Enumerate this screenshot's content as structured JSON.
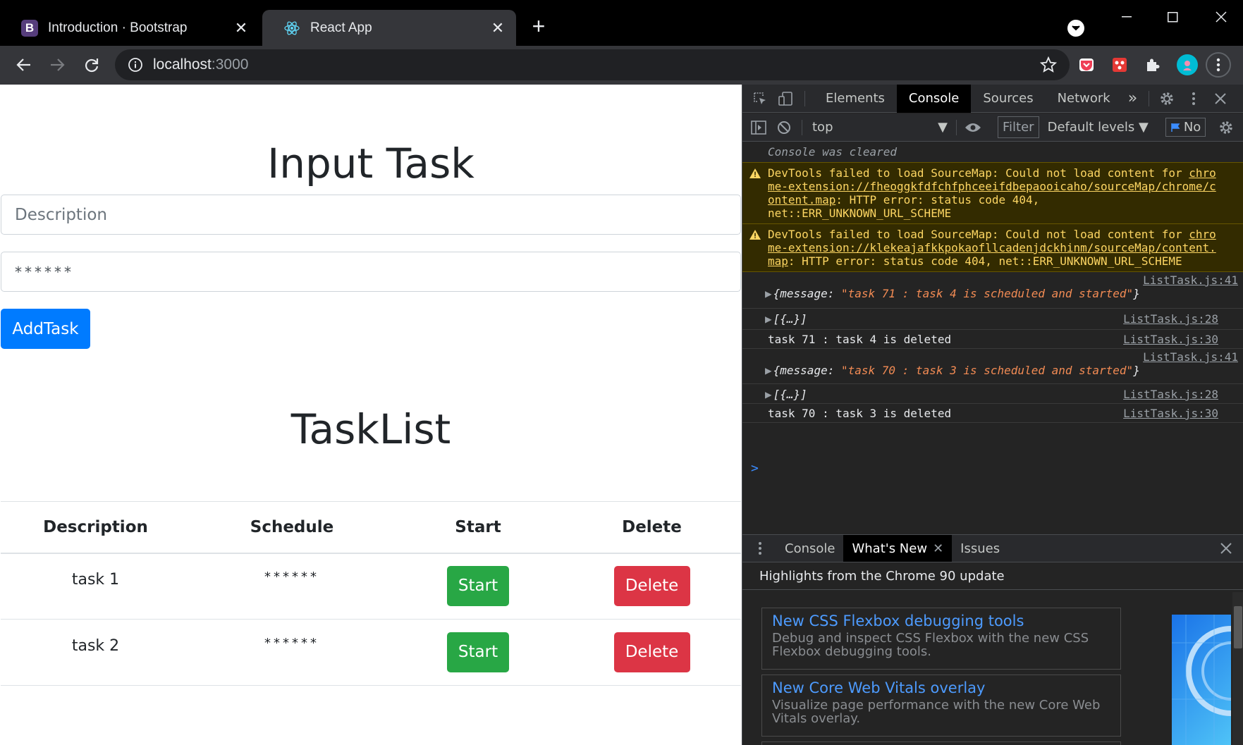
{
  "browser": {
    "tabs": [
      {
        "title": "Introduction · Bootstrap",
        "favicon": "B"
      },
      {
        "title": "React App"
      }
    ],
    "url_host": "localhost",
    "url_port": ":3000"
  },
  "page": {
    "input_title": "Input Task",
    "description_placeholder": "Description",
    "schedule_value": "******",
    "addtask_label": "AddTask",
    "list_title": "TaskList",
    "table": {
      "headers": [
        "Description",
        "Schedule",
        "Start",
        "Delete"
      ],
      "rows": [
        {
          "description": "task 1",
          "schedule": "******",
          "start": "Start",
          "delete": "Delete"
        },
        {
          "description": "task 2",
          "schedule": "******",
          "start": "Start",
          "delete": "Delete"
        }
      ]
    },
    "colors": {
      "primary": "#007bff",
      "success": "#28a745",
      "danger": "#dc3545"
    }
  },
  "devtools": {
    "tabs": [
      "Elements",
      "Console",
      "Sources",
      "Network"
    ],
    "active_tab": "Console",
    "more": "»",
    "context": "top",
    "filter_placeholder": "Filter",
    "levels": "Default levels",
    "issues_label": "No",
    "console": {
      "cleared": "Console was cleared",
      "warnings": [
        {
          "prefix": "DevTools failed to load SourceMap: Could not load content for ",
          "link": "chrome-extension://fheoggkfdfchfphceeifdbepaooicaho/sourceMap/chrome/content.map",
          "suffix": ": HTTP error: status code 404, net::ERR_UNKNOWN_URL_SCHEME"
        },
        {
          "prefix": "DevTools failed to load SourceMap: Could not load content for ",
          "link": "chrome-extension://klekeajafkkpokaofllcadenjdckhinm/sourceMap/content.map",
          "suffix": ": HTTP error: status code 404, net::ERR_UNKNOWN_URL_SCHEME"
        }
      ],
      "entries": [
        {
          "source": "ListTask.js:41",
          "obj_key": "{message: ",
          "obj_str": "\"task 71 : task 4 is scheduled and started\"",
          "obj_end": "}"
        },
        {
          "source": "ListTask.js:28",
          "text": "[{…}]"
        },
        {
          "source": "ListTask.js:30",
          "text": "task 71 : task 4 is deleted"
        },
        {
          "source": "ListTask.js:41",
          "obj_key": "{message: ",
          "obj_str": "\"task 70 : task 3 is scheduled and started\"",
          "obj_end": "}"
        },
        {
          "source": "ListTask.js:28",
          "text": "[{…}]"
        },
        {
          "source": "ListTask.js:30",
          "text": "task 70 : task 3 is deleted"
        }
      ],
      "prompt": ">"
    },
    "drawer": {
      "tabs": [
        "Console",
        "What's New",
        "Issues"
      ],
      "active_tab": "What's New",
      "header": "Highlights from the Chrome 90 update",
      "cards": [
        {
          "title": "New CSS Flexbox debugging tools",
          "desc": "Debug and inspect CSS Flexbox with the new CSS Flexbox debugging tools."
        },
        {
          "title": "New Core Web Vitals overlay",
          "desc": "Visualize page performance with the new Core Web Vitals overlay."
        }
      ]
    }
  }
}
